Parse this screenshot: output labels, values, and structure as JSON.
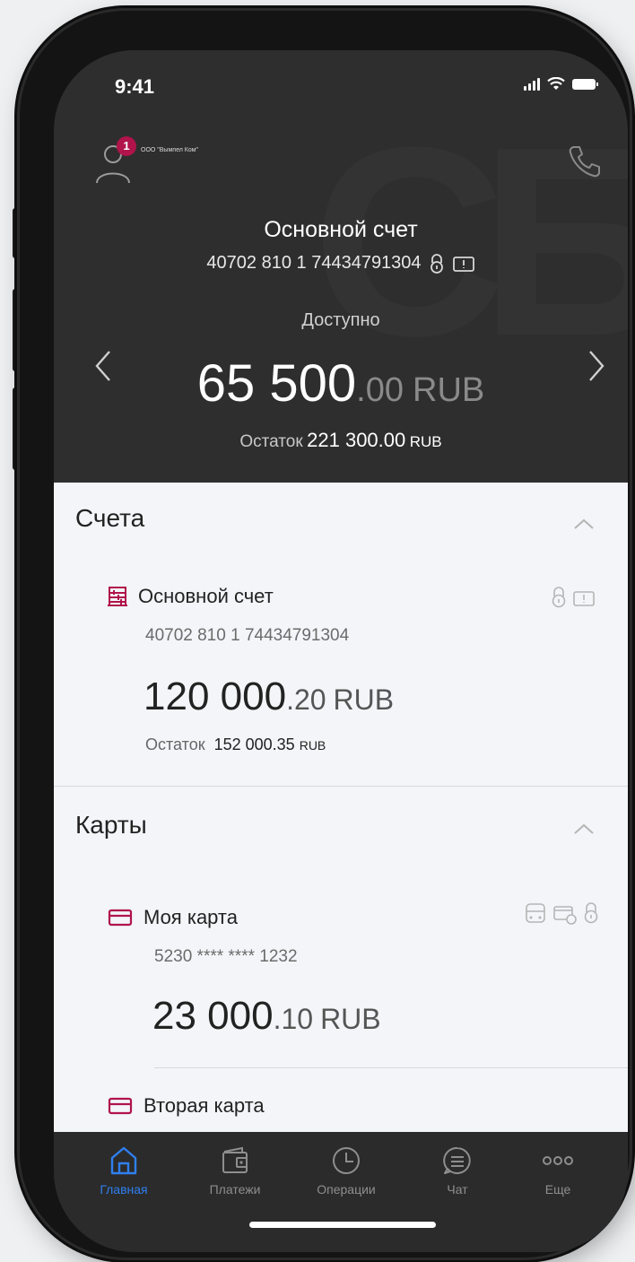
{
  "status": {
    "time": "9:41"
  },
  "header": {
    "company": "ООО \"Вымпел Ком\"",
    "badge_count": "1",
    "account_title": "Основной счет",
    "account_number": "40702 810 1 74434791304",
    "available_label": "Доступно",
    "balance_int": "65 500",
    "balance_dec": ".00",
    "currency": "RUB",
    "rest_label": "Остаток",
    "rest_value": "221 300.00",
    "rest_currency": "RUB"
  },
  "accounts": {
    "section_title": "Счета",
    "item": {
      "title": "Основной счет",
      "number": "40702 810 1 74434791304",
      "balance_int": "120 000",
      "balance_dec": ".20",
      "currency": "RUB",
      "rest_label": "Остаток",
      "rest_value": "152 000.35",
      "rest_currency": "RUB"
    }
  },
  "cards": {
    "section_title": "Карты",
    "items": [
      {
        "title": "Моя карта",
        "number": "5230 **** **** 1232",
        "balance_int": "23 000",
        "balance_dec": ".10",
        "currency": "RUB"
      },
      {
        "title": "Вторая карта"
      }
    ]
  },
  "tabbar": {
    "items": [
      {
        "label": "Главная",
        "icon": "home-icon",
        "active": true
      },
      {
        "label": "Платежи",
        "icon": "wallet-icon",
        "active": false
      },
      {
        "label": "Операции",
        "icon": "clock-icon",
        "active": false
      },
      {
        "label": "Чат",
        "icon": "chat-icon",
        "active": false
      },
      {
        "label": "Еще",
        "icon": "more-icon",
        "active": false
      }
    ]
  },
  "colors": {
    "accent": "#2f7ff0",
    "brand": "#b0144a",
    "header_bg": "#2e2e2e"
  }
}
